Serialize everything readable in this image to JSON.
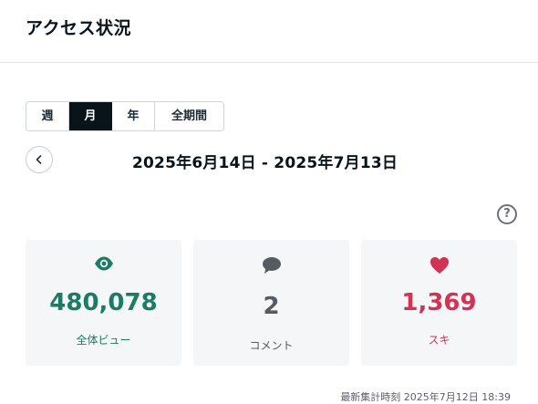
{
  "page": {
    "title": "アクセス状況"
  },
  "tabs": [
    {
      "label": "週",
      "active": false
    },
    {
      "label": "月",
      "active": true
    },
    {
      "label": "年",
      "active": false
    },
    {
      "label": "全期間",
      "active": false
    }
  ],
  "period": {
    "range": "2025年6月14日 - 2025年7月13日"
  },
  "help": {
    "glyph": "?"
  },
  "stats": [
    {
      "icon": "eye-icon",
      "value": "480,078",
      "label": "全体ビュー",
      "color": "#1d7a63"
    },
    {
      "icon": "comment-icon",
      "value": "2",
      "label": "コメント",
      "color": "#555b61"
    },
    {
      "icon": "heart-icon",
      "value": "1,369",
      "label": "スキ",
      "color": "#d13355"
    }
  ],
  "footer": {
    "updated": "最新集計時刻 2025年7月12日 18:39"
  }
}
